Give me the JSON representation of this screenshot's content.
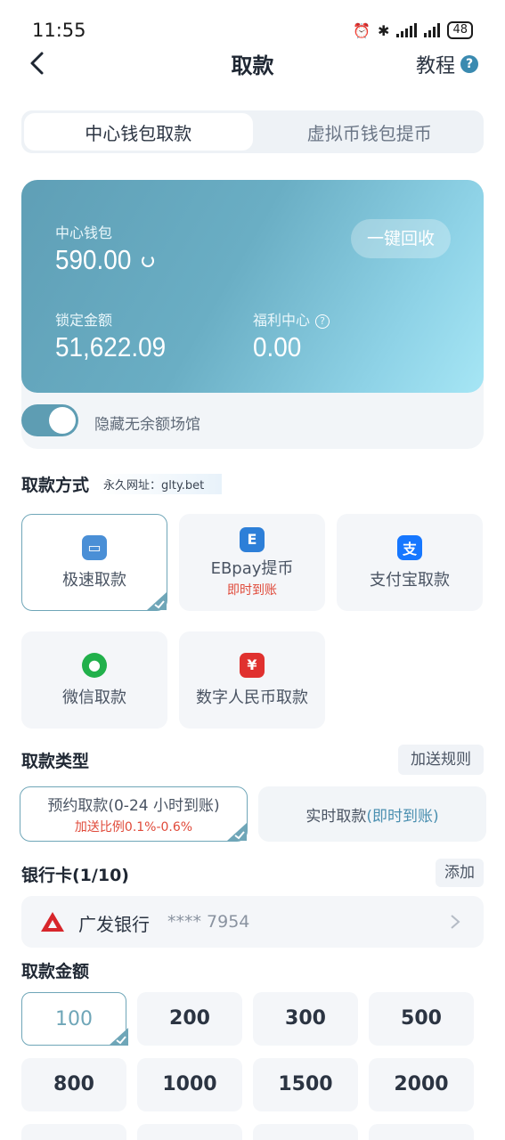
{
  "status_bar": {
    "time": "11:55",
    "battery": "48"
  },
  "nav": {
    "title": "取款",
    "tutorial": "教程",
    "help_icon": "?"
  },
  "tabs": [
    {
      "label": "中心钱包取款",
      "active": true
    },
    {
      "label": "虚拟币钱包提币",
      "active": false
    }
  ],
  "wallet": {
    "center_label": "中心钱包",
    "center_value": "590.00",
    "recall_button": "一键回收",
    "locked_label": "锁定金额",
    "locked_value": "51,622.09",
    "welfare_label": "福利中心",
    "welfare_value": "0.00"
  },
  "hide_toggle": {
    "label": "隐藏无余额场馆",
    "on": true
  },
  "methods_section": {
    "title": "取款方式",
    "url_label": "永久网址：glty.bet"
  },
  "methods": [
    {
      "label": "极速取款",
      "sub": "",
      "icon": "card-icon",
      "active": true
    },
    {
      "label": "EBpay提币",
      "sub": "即时到账",
      "icon": "ebpay-icon",
      "active": false
    },
    {
      "label": "支付宝取款",
      "sub": "",
      "icon": "alipay-icon",
      "active": false
    },
    {
      "label": "微信取款",
      "sub": "",
      "icon": "wechat-icon",
      "active": false
    },
    {
      "label": "数字人民币取款",
      "sub": "",
      "icon": "digital-rmb-icon",
      "active": false
    }
  ],
  "type_section": {
    "title": "取款类型",
    "rule_button": "加送规则"
  },
  "types": [
    {
      "main": "预约取款(0-24 小时到账)",
      "sub": "加送比例0.1%-0.6%",
      "active": true
    },
    {
      "main_prefix": "实时取款",
      "main_hl": "(即时到账)",
      "active": false
    }
  ],
  "bank_section": {
    "title": "银行卡(1/10)",
    "add_button": "添加"
  },
  "bank": {
    "name": "广发银行",
    "number": "**** 7954"
  },
  "amount_section": {
    "title": "取款金额"
  },
  "amounts": [
    "100",
    "200",
    "300",
    "500",
    "800",
    "1000",
    "1500",
    "2000"
  ],
  "colors": {
    "accent": "#6fa6b8",
    "wallet_start": "#5f9fb6",
    "wallet_end": "#a6e6f5",
    "warning": "#e04a3a"
  }
}
